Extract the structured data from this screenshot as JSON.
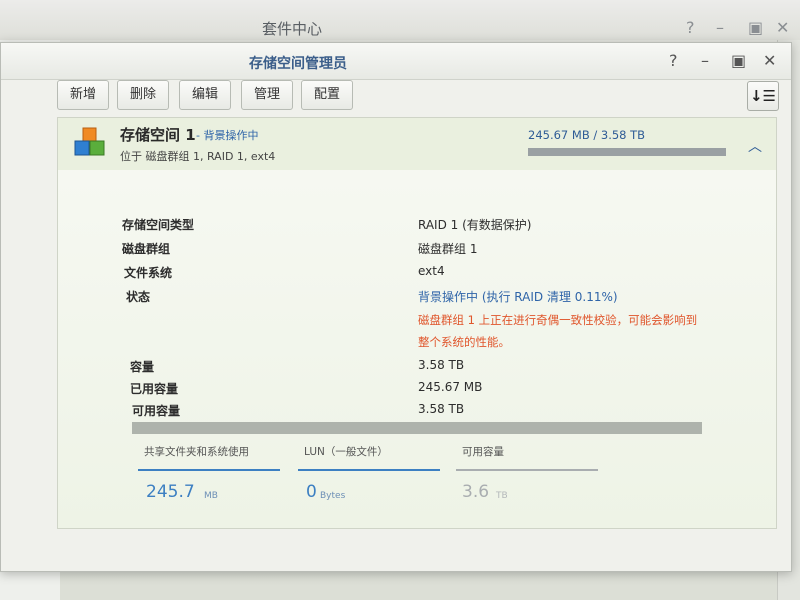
{
  "background_window": {
    "title": "套件中心"
  },
  "dialog": {
    "title": "存储空间管理员",
    "toolbar": {
      "add": "新增",
      "delete": "删除",
      "edit": "编辑",
      "manage": "管理",
      "configure": "配置"
    }
  },
  "volume": {
    "name": "存储空间 1",
    "status_label": "- 背景操作中",
    "description": "位于 磁盘群组 1, RAID 1, ext4",
    "usage_text": "245.67 MB / 3.58 TB",
    "usage_fraction": 0.0001,
    "details": {
      "type_label": "存储空间类型",
      "type_value": "RAID 1 (有数据保护)",
      "diskgroup_label": "磁盘群组",
      "diskgroup_value": "磁盘群组 1",
      "fs_label": "文件系统",
      "fs_value": "ext4",
      "status_label": "状态",
      "status_value": "背景操作中 (执行 RAID 清理 0.11%)",
      "warning_line1": "磁盘群组 1 上正在进行奇偶一致性校验，可能会影响到",
      "warning_line2": "整个系统的性能。",
      "capacity_label": "容量",
      "capacity_value": "3.58 TB",
      "used_label": "已用容量",
      "used_value": "245.67 MB",
      "available_label": "可用容量",
      "available_value": "3.58 TB"
    },
    "stats": [
      {
        "title": "共享文件夹和系统使用",
        "value": "245.7",
        "unit": "MB",
        "color": "#3c7fc2"
      },
      {
        "title": "LUN（一般文件）",
        "value": "0",
        "unit": "Bytes",
        "color": "#3c7fc2"
      },
      {
        "title": "可用容量",
        "value": "3.6",
        "unit": "TB",
        "color": "#a9adb0"
      }
    ]
  },
  "colors": {
    "accent_blue": "#2f64a8",
    "warning_red": "#e0562c"
  }
}
